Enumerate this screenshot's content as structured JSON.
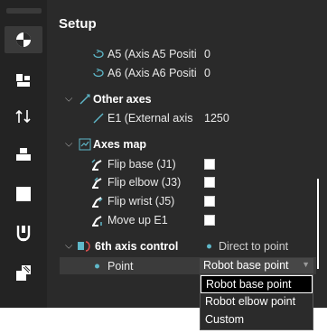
{
  "panel": {
    "title": "Setup"
  },
  "rows": {
    "a5": {
      "label": "A5 (Axis A5 Positi",
      "value": "0"
    },
    "a6": {
      "label": "A6 (Axis A6 Positi",
      "value": "0"
    },
    "other_axes": {
      "label": "Other axes"
    },
    "e1": {
      "label": "E1 (External axis ",
      "value": "1250"
    },
    "axes_map": {
      "label": "Axes map"
    },
    "flip_base": {
      "label": "Flip base (J1)"
    },
    "flip_elbow": {
      "label": "Flip elbow (J3)"
    },
    "flip_wrist": {
      "label": "Flip wrist (J5)"
    },
    "move_up": {
      "label": "Move up E1"
    },
    "sixth": {
      "label": "6th axis control",
      "mode": "Direct to point"
    },
    "point": {
      "label": "Point",
      "selected": "Robot base point"
    }
  },
  "dropdown": {
    "options": [
      "Robot base point",
      "Robot elbow point",
      "Custom"
    ]
  },
  "icons": [
    "target-icon",
    "robot-icon",
    "flip-icon",
    "layers-icon",
    "square-icon",
    "gripper-icon",
    "pattern-icon"
  ],
  "colors": {
    "bg": "#2a2a2a",
    "toolbar": "#232323",
    "accent": "#5fb8c9"
  }
}
